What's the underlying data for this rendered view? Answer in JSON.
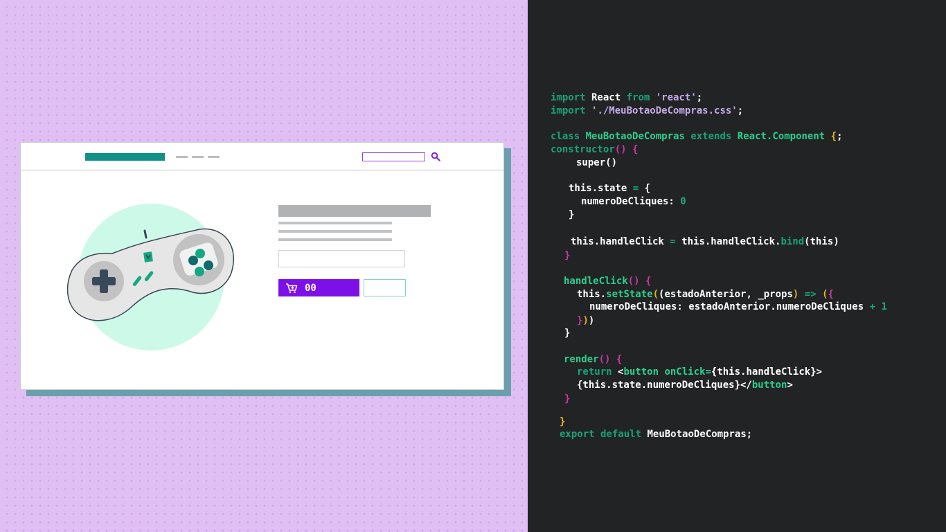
{
  "illustration": {
    "buy_button_count": "00",
    "colors": {
      "background": "#e0bff5",
      "brand_teal": "#0f9187",
      "cta_purple": "#7d10e6",
      "mint": "#cdfae8",
      "window_shadow": "#6a9fae"
    },
    "icons": [
      "search-icon",
      "cart-icon",
      "gamepad-illustration"
    ]
  },
  "code": {
    "language": "javascript",
    "colors": {
      "background": "#222324",
      "keyword": "#17a57b",
      "class_name": "#2ad28e",
      "string": "#c5a9ec",
      "bracket_yellow": "#e8b21a",
      "bracket_magenta": "#c638a5"
    },
    "lines": [
      [
        [
          "kw",
          "import"
        ],
        [
          "var",
          " React "
        ],
        [
          "kw",
          "from"
        ],
        [
          "var",
          " "
        ],
        [
          "str",
          "'react'"
        ],
        [
          "pun",
          ";"
        ]
      ],
      [
        [
          "kw",
          "import"
        ],
        [
          "var",
          " "
        ],
        [
          "str",
          "'./MeuBotaoDeCompras.css'"
        ],
        [
          "pun",
          ";"
        ]
      ],
      [
        [
          "kw",
          "class"
        ],
        [
          "var",
          " "
        ],
        [
          "cls",
          "MeuBotaoDeCompras"
        ],
        [
          "var",
          " "
        ],
        [
          "kw",
          "extends"
        ],
        [
          "var",
          " "
        ],
        [
          "cls",
          "React.Component"
        ],
        [
          "var",
          " "
        ],
        [
          "br1",
          "{"
        ],
        [
          "pun",
          ";"
        ]
      ],
      [
        [
          "kw",
          "constructor"
        ],
        [
          "br2",
          "()"
        ],
        [
          "var",
          " "
        ],
        [
          "br2",
          "{"
        ]
      ],
      [
        [
          "var",
          "super()"
        ]
      ],
      [
        [
          "var",
          "this.state "
        ],
        [
          "kw",
          "="
        ],
        [
          "var",
          " {"
        ]
      ],
      [
        [
          "var",
          "numeroDeCliques: "
        ],
        [
          "num",
          "0"
        ]
      ],
      [
        [
          "var",
          "}"
        ]
      ],
      [
        [
          "var",
          "this.handleClick "
        ],
        [
          "kw",
          "="
        ],
        [
          "var",
          " this.handleClick."
        ],
        [
          "kw",
          "bind"
        ],
        [
          "var",
          "(this)"
        ]
      ],
      [
        [
          "br2",
          "}"
        ]
      ],
      [
        [
          "cls",
          "handleClick"
        ],
        [
          "br2",
          "()"
        ],
        [
          "var",
          " "
        ],
        [
          "br2",
          "{"
        ]
      ],
      [
        [
          "var",
          "this."
        ],
        [
          "cls",
          "setState"
        ],
        [
          "br1",
          "("
        ],
        [
          "var",
          "(estadoAnterior, _props"
        ],
        [
          "br1",
          ")"
        ],
        [
          "var",
          " "
        ],
        [
          "kw",
          "=>"
        ],
        [
          "var",
          " "
        ],
        [
          "br1",
          "("
        ],
        [
          "br2",
          "{"
        ]
      ],
      [
        [
          "var",
          "numeroDeCliques: estadoAnterior.numeroDeCliques "
        ],
        [
          "kw",
          "+"
        ],
        [
          "var",
          " "
        ],
        [
          "num",
          "1"
        ]
      ],
      [
        [
          "br2",
          "}"
        ],
        [
          "br1",
          ")"
        ],
        [
          "var",
          ")"
        ]
      ],
      [
        [
          "var",
          "}"
        ]
      ],
      [
        [
          "cls",
          "render"
        ],
        [
          "br2",
          "()"
        ],
        [
          "var",
          " "
        ],
        [
          "br2",
          "{"
        ]
      ],
      [
        [
          "kw",
          "return"
        ],
        [
          "var",
          " <"
        ],
        [
          "cls",
          "button"
        ],
        [
          "var",
          " "
        ],
        [
          "cls",
          "onClick="
        ],
        [
          "var",
          "{this.handleClick}>"
        ]
      ],
      [
        [
          "var",
          "{this.state.numeroDeCliques}</"
        ],
        [
          "cls",
          "button"
        ],
        [
          "var",
          ">"
        ]
      ],
      [
        [
          "br2",
          "}"
        ]
      ],
      [
        [
          "br1",
          "}"
        ]
      ],
      [
        [
          "kw",
          "export"
        ],
        [
          "var",
          " "
        ],
        [
          "kw",
          "default"
        ],
        [
          "var",
          " MeuBotaoDeCompras;"
        ]
      ]
    ]
  }
}
